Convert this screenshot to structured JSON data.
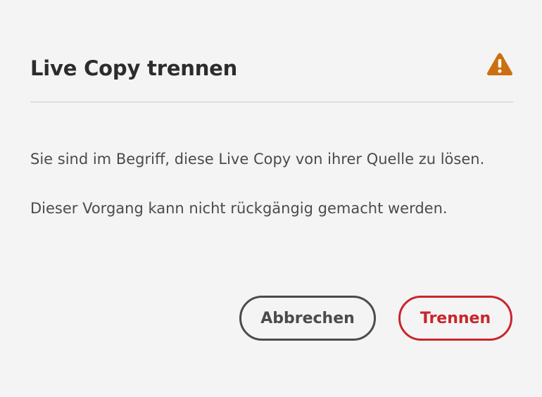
{
  "dialog": {
    "title": "Live Copy trennen",
    "icon": "alert-triangle-icon",
    "accent_warning": "#cb6f10",
    "message_line1": "Sie sind im Begriff, diese Live Copy von ihrer Quelle zu lösen.",
    "message_line2": "Dieser Vorgang kann nicht rückgängig gemacht werden.",
    "buttons": {
      "cancel_label": "Abbrechen",
      "confirm_label": "Trennen",
      "confirm_color": "#c9252d"
    }
  }
}
